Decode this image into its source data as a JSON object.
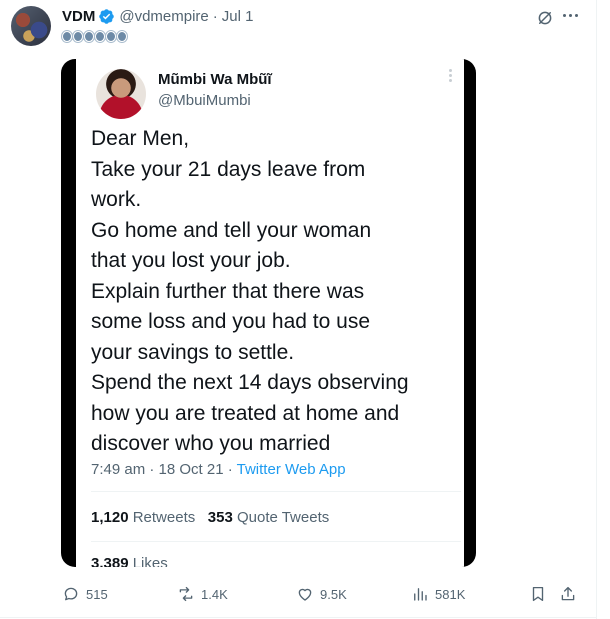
{
  "post": {
    "author_name": "VDM",
    "handle": "@vdmempire",
    "separator": "·",
    "time": "Jul 1"
  },
  "embedded": {
    "name": "Mũmbi Wa Mbũĩ",
    "handle": "@MbuiMumbi",
    "text_lines": [
      "Dear Men,",
      "Take your 21 days leave from",
      "work.",
      "Go home and tell your woman",
      "that you lost your job.",
      "Explain further that there was",
      "some loss and you had to use",
      "your savings to settle.",
      "Spend the next 14 days observing",
      "how you are treated at home and",
      "discover who you married"
    ],
    "timestamp": "7:49 am · 18 Oct 21 · ",
    "app": "Twitter Web App",
    "retweets_count": "1,120",
    "retweets_label": "Retweets",
    "quotes_count": "353",
    "quotes_label": "Quote Tweets",
    "likes_count": "3,389",
    "likes_label": "Likes"
  },
  "actions": {
    "replies": "515",
    "reposts": "1.4K",
    "likes": "9.5K",
    "views": "581K"
  },
  "colors": {
    "accent": "#1d9bf0",
    "muted": "#536471",
    "text": "#0f1419"
  }
}
